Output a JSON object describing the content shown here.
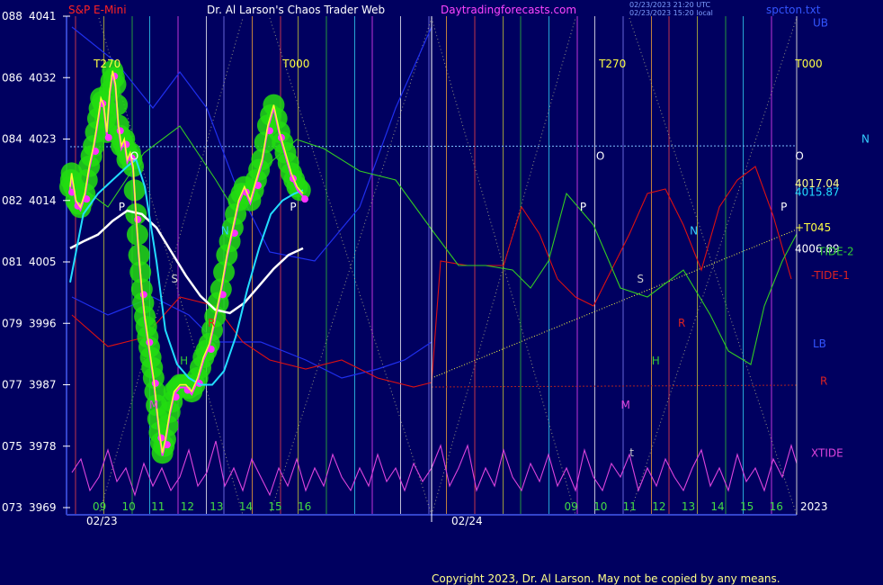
{
  "header": {
    "symbol": "S&P E-Mini",
    "title": "Dr. Al Larson's Chaos Trader Web",
    "site": "Daytradingforecasts.com",
    "stamp_line1": "02/23/2023 21:20 UTC",
    "stamp_line2": "02/23/2023 15:20 local",
    "file": "spcton.txt"
  },
  "copyright": "Copyright 2023, Dr. Al Larson. May not be copied by any means.",
  "colors": {
    "background": "#000060",
    "price_green_blobs": "#22dd11",
    "price_magenta": "#ff22ff",
    "price_yellow": "#ffff33",
    "ma_cyan": "#22ddff",
    "ma_white": "#ffffff",
    "tide_red": "#dd1111",
    "tide2_green": "#33cc22",
    "xtide_magenta": "#dd44dd",
    "ub_lb_blue": "#1122ee",
    "level_label": "#ffffff",
    "copyright": "#ffff88"
  },
  "chart_data": {
    "type": "line",
    "title": "Dr. Al Larson's Chaos Trader Web",
    "xlabel": "",
    "ylabel": "",
    "ylim": [
      3969,
      4041
    ],
    "y_ticks": [
      {
        "left": "088",
        "value": 4041
      },
      {
        "left": "086",
        "value": 4032
      },
      {
        "left": "084",
        "value": 4023
      },
      {
        "left": "082",
        "value": 4014
      },
      {
        "left": "081",
        "value": 4005
      },
      {
        "left": "079",
        "value": 3996
      },
      {
        "left": "077",
        "value": 3987
      },
      {
        "left": "075",
        "value": 3978
      },
      {
        "left": "073",
        "value": 3969
      }
    ],
    "x_hours_day1": [
      "09",
      "10",
      "11",
      "12",
      "13",
      "14",
      "15",
      "16"
    ],
    "x_hours_day2": [
      "09",
      "10",
      "11",
      "12",
      "13",
      "14",
      "15",
      "16"
    ],
    "dates": [
      "02/23",
      "02/24"
    ],
    "year_label": "2023",
    "right_labels": [
      {
        "text": "UB",
        "value": 4040
      },
      {
        "text": "N",
        "value": 4023
      },
      {
        "text": "4017.04",
        "value": 4016.5
      },
      {
        "text": "4015.87",
        "value": 4015.2
      },
      {
        "text": "+T045",
        "value": 4010
      },
      {
        "text": "4006.89",
        "value": 4006.9
      },
      {
        "text": "TIDE-2",
        "value": 4006.5
      },
      {
        "text": "-TIDE-1",
        "value": 4003
      },
      {
        "text": "LB",
        "value": 3993
      },
      {
        "text": "R",
        "value": 3987.5
      },
      {
        "text": "XTIDE",
        "value": 3977
      }
    ],
    "chart_markers": [
      {
        "text": "T270",
        "x": 8.85,
        "y": 4033.5
      },
      {
        "text": "T000",
        "x": 15.3,
        "y": 4033.5
      },
      {
        "text": "T270",
        "x": 26.1,
        "y": 4033.5
      },
      {
        "text": "T000",
        "x": 32.8,
        "y": 4033.5
      },
      {
        "text": "O",
        "x": 10.1,
        "y": 4020
      },
      {
        "text": "O",
        "x": 26.0,
        "y": 4020
      },
      {
        "text": "O",
        "x": 32.8,
        "y": 4020
      },
      {
        "text": "P",
        "x": 9.7,
        "y": 4012.5
      },
      {
        "text": "P",
        "x": 15.55,
        "y": 4012.5
      },
      {
        "text": "P",
        "x": 25.45,
        "y": 4012.5
      },
      {
        "text": "P",
        "x": 32.3,
        "y": 4012.5
      },
      {
        "text": "N",
        "x": 13.2,
        "y": 4009
      },
      {
        "text": "N",
        "x": 29.2,
        "y": 4009
      },
      {
        "text": "S",
        "x": 11.5,
        "y": 4002
      },
      {
        "text": "S",
        "x": 27.4,
        "y": 4002
      },
      {
        "text": "R",
        "x": 12.75,
        "y": 3995.5
      },
      {
        "text": "R",
        "x": 28.8,
        "y": 3995.5
      },
      {
        "text": "H",
        "x": 11.8,
        "y": 3990
      },
      {
        "text": "H",
        "x": 27.9,
        "y": 3990
      },
      {
        "text": "M",
        "x": 10.75,
        "y": 3983.5
      },
      {
        "text": "M",
        "x": 26.85,
        "y": 3983.5
      },
      {
        "text": "t",
        "x": 27.15,
        "y": 3976.5
      }
    ],
    "x_domain": [
      8.05,
      32.85
    ],
    "series": [
      {
        "key": "price",
        "x": [
          8.05,
          8.1,
          8.25,
          8.4,
          8.55,
          8.7,
          8.85,
          9.0,
          9.1,
          9.2,
          9.3,
          9.4,
          9.5,
          9.6,
          9.7,
          9.8,
          9.9,
          10.0,
          10.1,
          10.2,
          10.3,
          10.4,
          10.5,
          10.6,
          10.7,
          10.8,
          10.9,
          11.0,
          11.1,
          11.2,
          11.3,
          11.45,
          11.6,
          11.8,
          12.0,
          12.2,
          12.4,
          12.6,
          12.8,
          13.0,
          13.2,
          13.4,
          13.6,
          13.8,
          14.0,
          14.2,
          14.4,
          14.6,
          14.8,
          15.0,
          15.2,
          15.4,
          15.6,
          15.8,
          16.0
        ],
        "y": [
          4016,
          4018,
          4014,
          4013,
          4015,
          4019,
          4022,
          4026,
          4029,
          4028,
          4024,
          4030,
          4033,
          4031,
          4025,
          4022,
          4023,
          4020,
          4021,
          4019,
          4012,
          4006,
          4001,
          3997,
          3994,
          3991,
          3988,
          3984,
          3980,
          3977,
          3979,
          3983,
          3986,
          3987,
          3987,
          3986,
          3988,
          3991,
          3993,
          3997,
          4001,
          4006,
          4010,
          4014,
          4016,
          4014,
          4017,
          4020,
          4025,
          4028,
          4024,
          4021,
          4018,
          4016,
          4015
        ]
      },
      {
        "key": "ma_cyan",
        "x": [
          8.05,
          8.5,
          9.0,
          9.5,
          10.0,
          10.3,
          10.6,
          11.0,
          11.3,
          11.7,
          12.1,
          12.5,
          12.9,
          13.3,
          13.7,
          14.1,
          14.5,
          14.9,
          15.3,
          15.7,
          16.0
        ],
        "y": [
          4002,
          4012,
          4015,
          4017,
          4019,
          4020,
          4016,
          4005,
          3995,
          3990,
          3988,
          3987,
          3987,
          3989,
          3994,
          4001,
          4007,
          4012,
          4014,
          4015,
          4015.5
        ]
      },
      {
        "key": "ma_white",
        "x": [
          8.05,
          8.5,
          9.0,
          9.5,
          10.0,
          10.5,
          11.0,
          11.5,
          12.0,
          12.5,
          13.0,
          13.5,
          14.0,
          14.5,
          15.0,
          15.5,
          16.0
        ],
        "y": [
          4007,
          4008,
          4009,
          4011,
          4012.5,
          4012,
          4010,
          4006.5,
          4003,
          4000,
          3998,
          3997.5,
          3999,
          4001.5,
          4004,
          4006,
          4007
        ]
      }
    ]
  }
}
